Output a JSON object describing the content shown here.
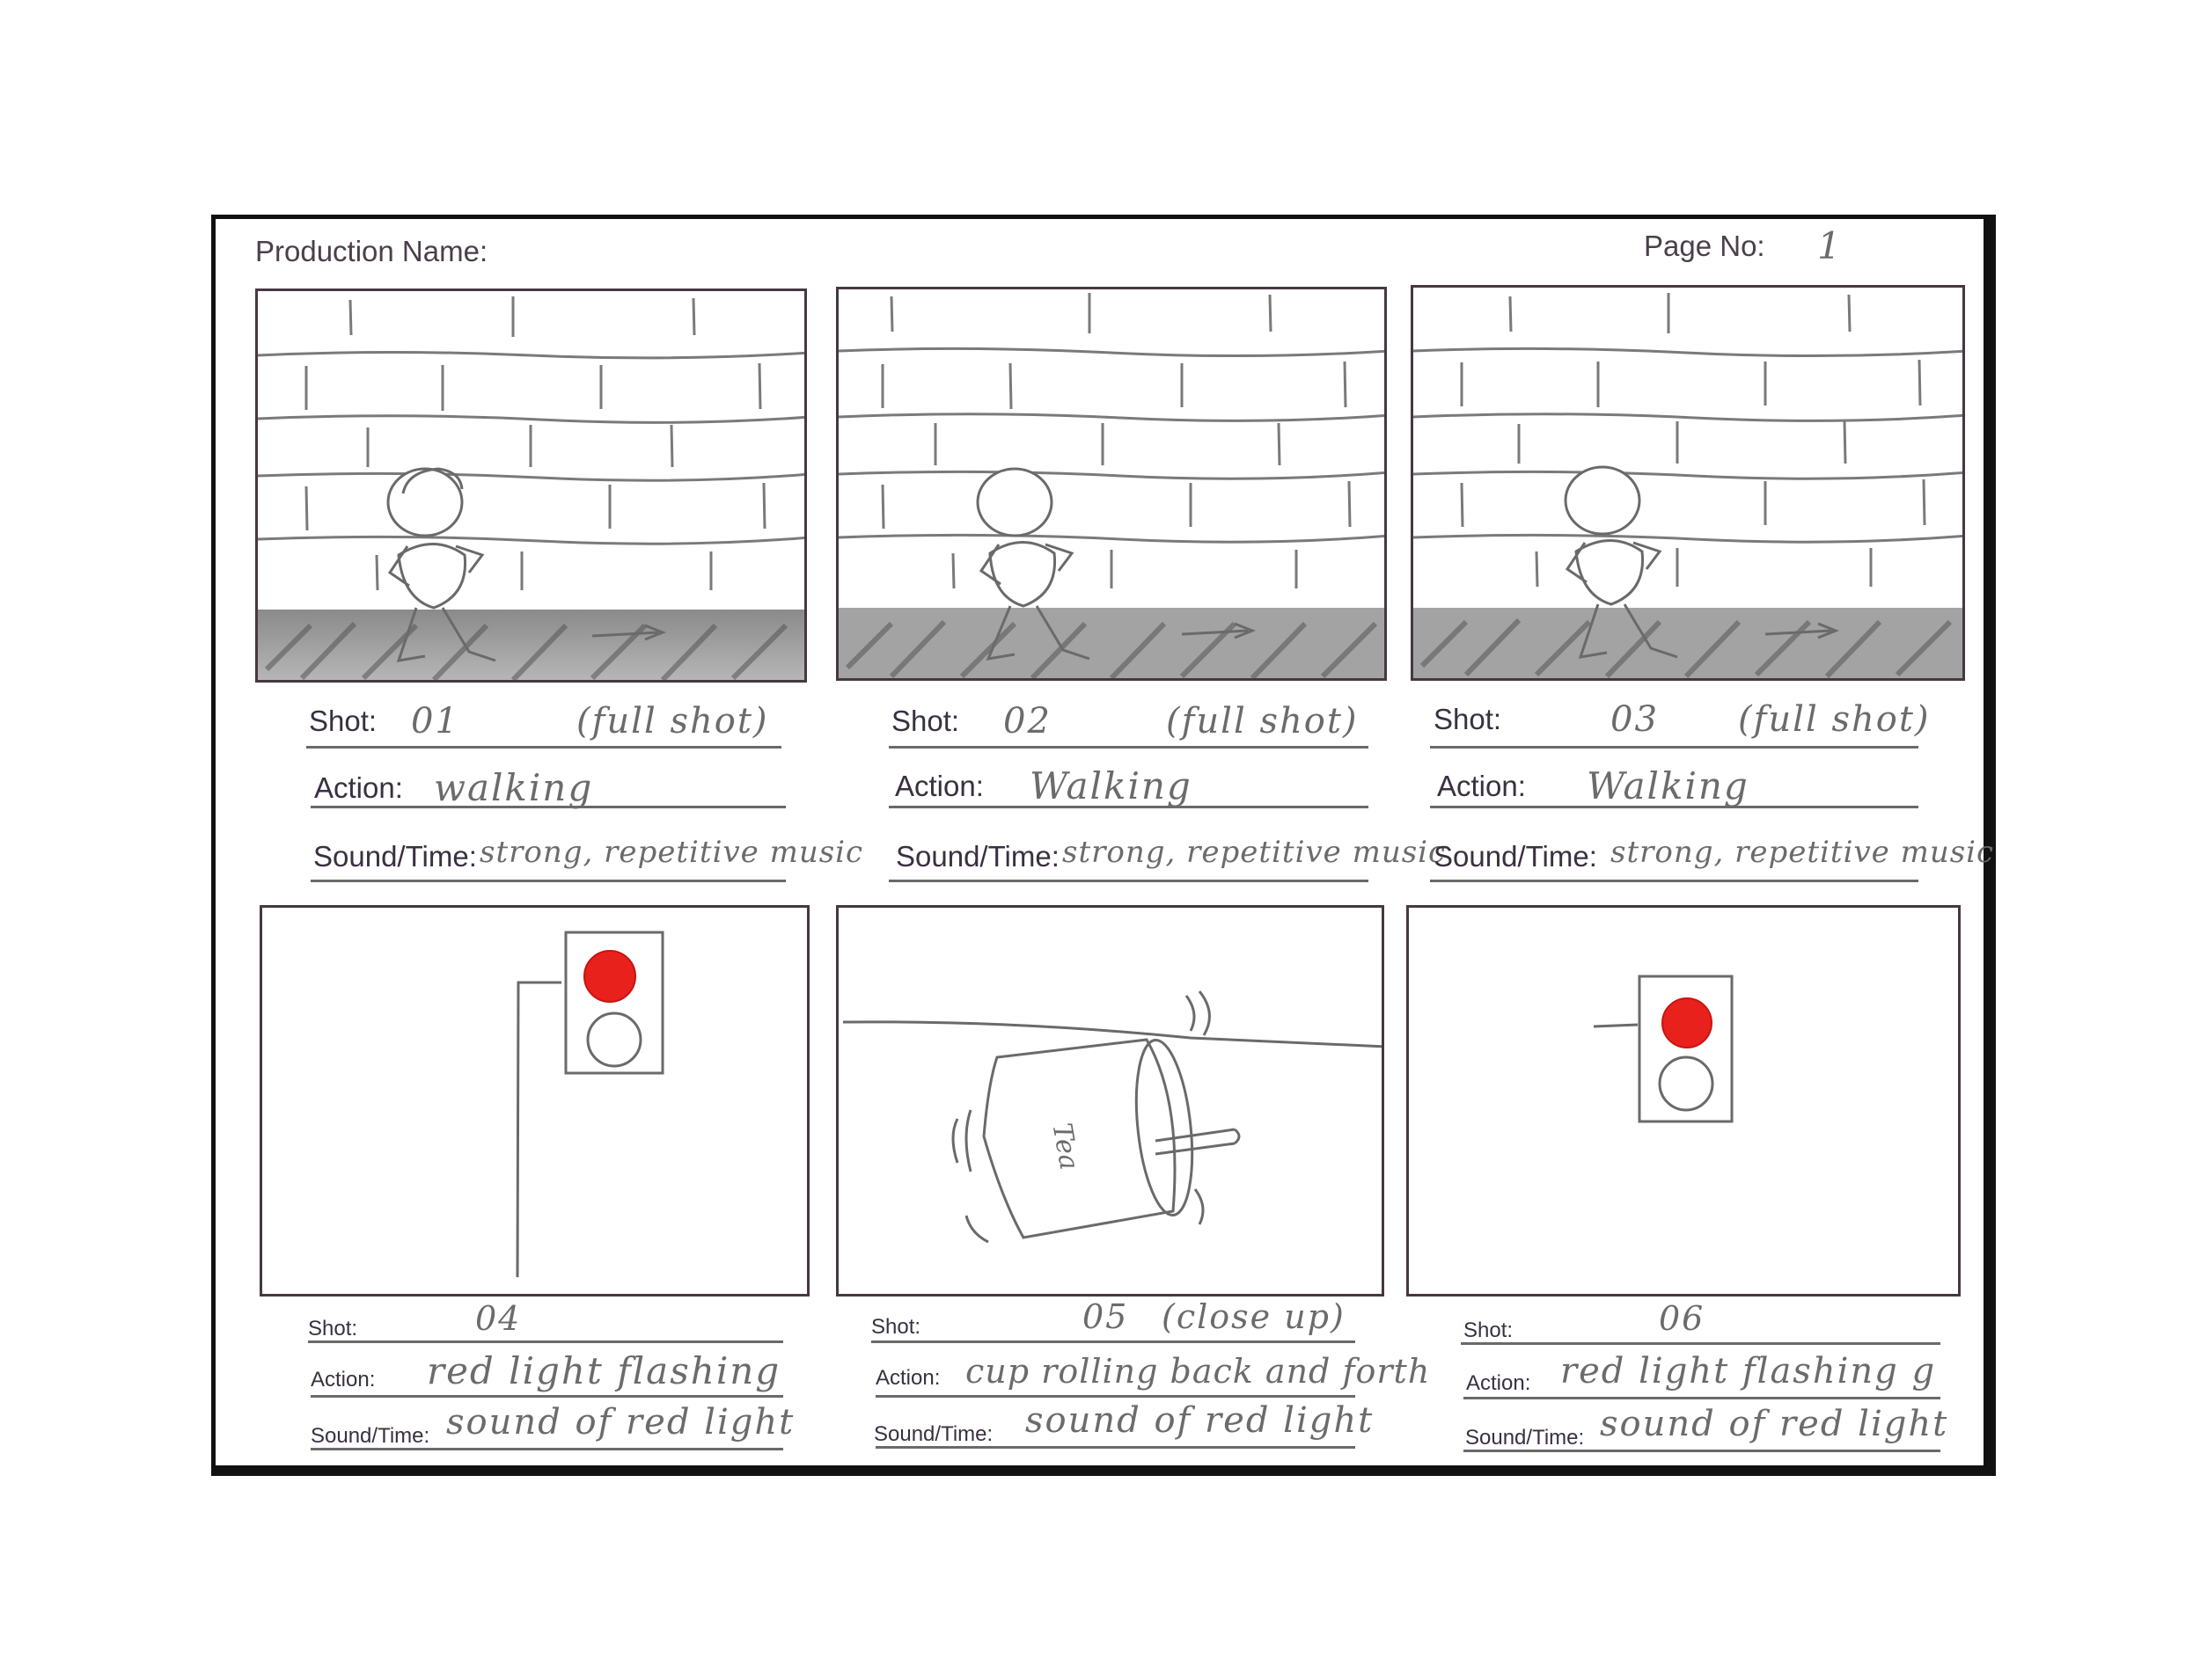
{
  "header": {
    "production_label": "Production Name:",
    "page_label": "Page No:",
    "page_value": "1"
  },
  "labels": {
    "shot": "Shot:",
    "action": "Action:",
    "sound": "Sound/Time:"
  },
  "panels": [
    {
      "shot": "01",
      "shot_note": "(full shot)",
      "action": "walking",
      "sound": "strong, repetitive music"
    },
    {
      "shot": "02",
      "shot_note": "(full shot)",
      "action": "Walking",
      "sound": "strong, repetitive music"
    },
    {
      "shot": "03",
      "shot_note": "(full shot)",
      "action": "Walking",
      "sound": "strong, repetitive music"
    },
    {
      "shot": "04",
      "shot_note": "",
      "action": "red light flashing",
      "sound": "sound of red light"
    },
    {
      "shot": "05",
      "shot_note": "(close up)",
      "action": "cup rolling back and forth",
      "sound": "sound of red light"
    },
    {
      "shot": "06",
      "shot_note": "",
      "action": "red light flashing g",
      "sound": "sound of red light"
    }
  ],
  "drawing_text": {
    "cup_label": "Tea"
  },
  "colors": {
    "frame_border": "#463843",
    "pencil": "#707070",
    "red_light": "#e8211c"
  }
}
